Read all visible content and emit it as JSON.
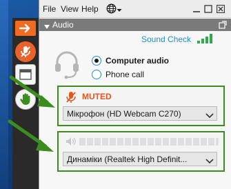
{
  "menubar": {
    "items": [
      "File",
      "View",
      "Help"
    ]
  },
  "audio_panel": {
    "header": "Audio",
    "sound_check": "Sound Check",
    "connection": {
      "computer_audio_label": "Computer audio",
      "phone_call_label": "Phone call",
      "selected": "Computer audio"
    },
    "microphone": {
      "status": "MUTED",
      "device": "Мікрофон (HD Webcam C270)"
    },
    "speaker": {
      "device": "Динаміки (Realtek  High Definit..."
    }
  },
  "colors": {
    "accent_orange": "#e8632b",
    "link_blue": "#1f8fcf",
    "highlight_green": "#3c8d1f",
    "signal_green": "#2fa84f",
    "header_gray": "#7a7a7a"
  },
  "icons": [
    "arrow-right-icon",
    "muted-mic-icon",
    "window-icon",
    "raise-hand-icon",
    "globe-icon",
    "chevron-down-icon",
    "minimize-icon",
    "restore-icon",
    "close-icon",
    "popout-icon",
    "signal-bars-icon",
    "headset-icon",
    "speaker-icon"
  ]
}
